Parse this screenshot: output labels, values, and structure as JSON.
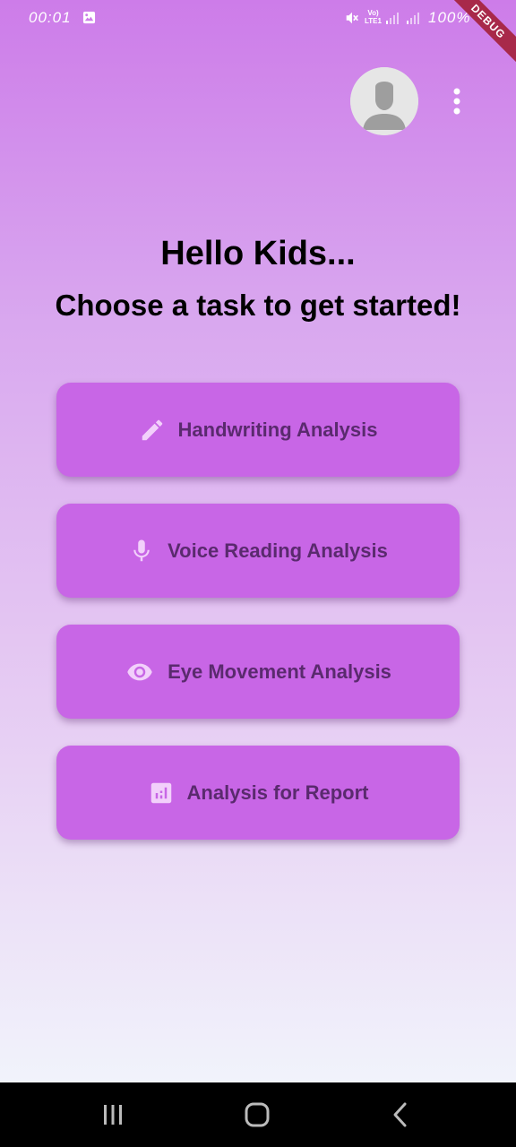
{
  "status_bar": {
    "time": "00:01",
    "network": "Vo)\nLTE1",
    "battery": "100%",
    "icons": [
      "gallery-icon",
      "mute-icon",
      "signal-icon",
      "battery-icon"
    ]
  },
  "debug_banner": "DEBUG",
  "header": {
    "avatar_icon": "person-icon",
    "menu_icon": "more-vertical-icon"
  },
  "main": {
    "greeting": "Hello Kids...",
    "subtitle": "Choose a task to get started!",
    "tasks": [
      {
        "label": "Handwriting Analysis",
        "icon": "pencil-icon"
      },
      {
        "label": "Voice Reading Analysis",
        "icon": "microphone-icon"
      },
      {
        "label": "Eye Movement Analysis",
        "icon": "eye-icon"
      },
      {
        "label": "Analysis for Report",
        "icon": "bar-chart-icon"
      }
    ]
  },
  "nav_bar": {
    "items": [
      "recent-apps-icon",
      "home-icon",
      "back-icon"
    ]
  },
  "colors": {
    "gradient_top": "#cd7ce9",
    "gradient_bottom": "#f1f3fb",
    "button_bg": "#c866e6",
    "button_text": "#5a2a6e",
    "icon_tint": "#f2d0fb",
    "debug_ribbon": "#a8294a"
  }
}
